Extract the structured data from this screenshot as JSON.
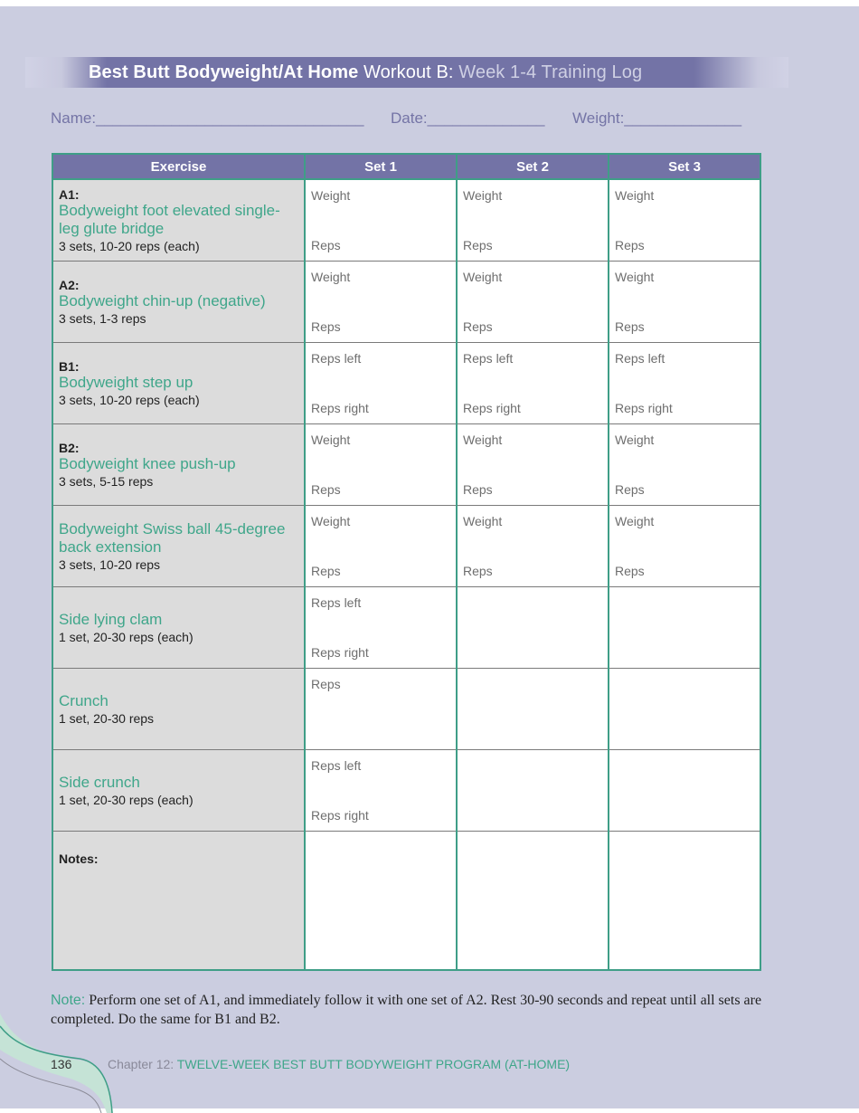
{
  "header": {
    "title_part1": "Best Butt Bodyweight/At Home",
    "title_part2": " Workout B:",
    "title_part3": " Week 1-4 Training Log"
  },
  "fields": {
    "name_label": "Name:",
    "name_line": "________________________________",
    "date_label": "Date:",
    "date_line": "______________",
    "weight_label": "Weight:",
    "weight_line": "______________"
  },
  "table": {
    "columns": [
      "Exercise",
      "Set 1",
      "Set 2",
      "Set 3"
    ],
    "rows": [
      {
        "code": "A1:",
        "name": "Bodyweight foot elevated single-leg glute bridge",
        "sets": "3 sets, 10-20 reps (each)",
        "set1": [
          "Weight",
          "Reps"
        ],
        "set2": [
          "Weight",
          "Reps"
        ],
        "set3": [
          "Weight",
          "Reps"
        ]
      },
      {
        "code": "A2:",
        "name": "Bodyweight chin-up (negative)",
        "sets": "3 sets, 1-3 reps",
        "set1": [
          "Weight",
          "Reps"
        ],
        "set2": [
          "Weight",
          "Reps"
        ],
        "set3": [
          "Weight",
          "Reps"
        ]
      },
      {
        "code": "B1:",
        "name": "Bodyweight step up",
        "sets": "3 sets, 10-20 reps (each)",
        "set1": [
          "Reps left",
          "Reps right"
        ],
        "set2": [
          "Reps left",
          "Reps right"
        ],
        "set3": [
          "Reps left",
          "Reps right"
        ]
      },
      {
        "code": "B2:",
        "name": "Bodyweight knee push-up",
        "sets": "3 sets, 5-15 reps",
        "set1": [
          "Weight",
          "Reps"
        ],
        "set2": [
          "Weight",
          "Reps"
        ],
        "set3": [
          "Weight",
          "Reps"
        ]
      },
      {
        "code": "",
        "name": "Bodyweight Swiss ball 45-degree back extension",
        "sets": "3 sets, 10-20 reps",
        "set1": [
          "Weight",
          "Reps"
        ],
        "set2": [
          "Weight",
          "Reps"
        ],
        "set3": [
          "Weight",
          "Reps"
        ]
      },
      {
        "code": "",
        "name": "Side lying clam",
        "sets": "1 set, 20-30 reps (each)",
        "set1": [
          "Reps left",
          "Reps right"
        ],
        "set2": [
          "",
          ""
        ],
        "set3": [
          "",
          ""
        ]
      },
      {
        "code": "",
        "name": "Crunch",
        "sets": "1 set, 20-30 reps",
        "set1": [
          "Reps",
          ""
        ],
        "set2": [
          "",
          ""
        ],
        "set3": [
          "",
          ""
        ]
      },
      {
        "code": "",
        "name": "Side crunch",
        "sets": "1 set, 20-30 reps (each)",
        "set1": [
          "Reps left",
          "Reps right"
        ],
        "set2": [
          "",
          ""
        ],
        "set3": [
          "",
          ""
        ]
      }
    ],
    "notes_label": "Notes:"
  },
  "note": {
    "label": "Note:",
    "text": " Perform one set of A1, and immediately follow it with one set of A2. Rest 30-90 seconds and repeat until all sets are completed. Do the same for B1 and B2."
  },
  "footer": {
    "page_number": "136",
    "chapter_prefix": "Chapter 12: ",
    "chapter_title": "TWELVE-WEEK BEST BUTT BODYWEIGHT PROGRAM (AT-HOME)"
  },
  "colors": {
    "page_bg": "#cbcde0",
    "header_purple": "#7373a6",
    "accent_green": "#3fa68a",
    "border_teal": "#3f9e87",
    "exercise_cell_bg": "#dcdcdc"
  }
}
